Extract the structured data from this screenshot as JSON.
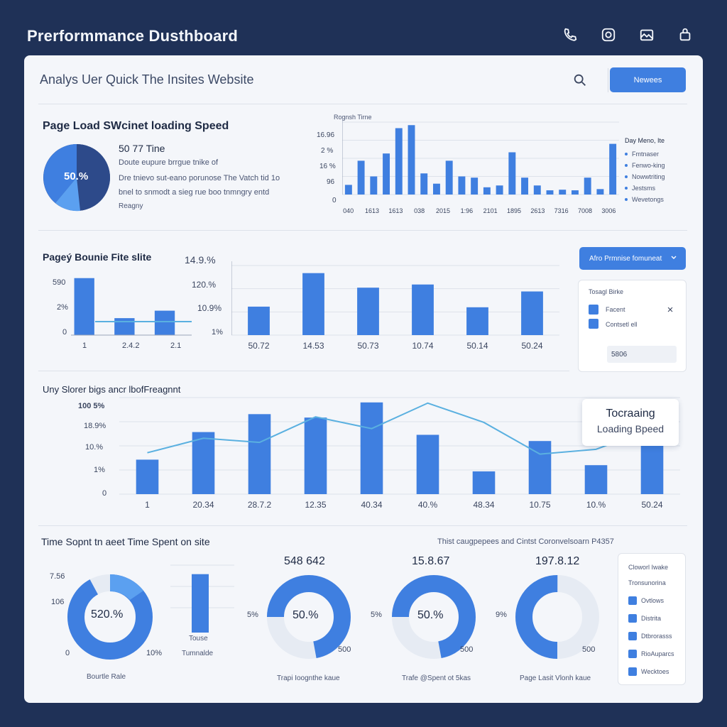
{
  "app_title": "Prerformmance Dusthboard",
  "top_icons": [
    "phone-icon",
    "camera-icon",
    "image-icon",
    "bag-icon"
  ],
  "header": {
    "subtitle": "Analys Uer Quick The Insites Website",
    "button_label": "Newees"
  },
  "colors": {
    "accent": "#3f7fe0",
    "dark": "#1f3157",
    "panel": "#f4f6fa",
    "line": "#5ab0e0"
  },
  "section1": {
    "title": "Page Load SWcinet loading Speed",
    "donut_label": "50.%",
    "info_value": "50 77 Tine",
    "info_lines": [
      "Doute eupure brrgue tnike of",
      "Dre tnievo sut-eano porunose The Vatch tid 1o",
      "bnel to snmodt a sieg rue boo tnmngry entd",
      "Reagny"
    ],
    "chart_title": "Rognsh Tirne",
    "y_ticks": [
      "16.96",
      "2 %",
      "16 %",
      "96",
      "0"
    ],
    "x_ticks": [
      "040",
      "1613",
      "1613",
      "038",
      "2015",
      "1:96",
      "2101",
      "1895",
      "2613",
      "7316",
      "7008",
      "3006"
    ],
    "legend_title": "Day Meno, Ite",
    "legend_items": [
      "Fmtnaser",
      "Fenwo-king",
      "Nowwtriting",
      "Jestsms",
      "Wevetongs"
    ]
  },
  "chart_data": [
    {
      "type": "bar",
      "title": "Rognsh Tirne",
      "values": [
        16,
        56,
        30,
        68,
        110,
        115,
        35,
        18,
        56,
        30,
        28,
        12,
        15,
        70,
        28,
        15,
        7,
        8,
        7,
        28,
        9,
        84
      ],
      "ylim": [
        0,
        120
      ]
    },
    {
      "type": "bar",
      "title": "Pageý Bounie Fite slite",
      "values": [
        84,
        25,
        36
      ],
      "y_ticks": [
        "590",
        "2%",
        "0"
      ],
      "x_ticks": [
        "1",
        "2.4.2",
        "2.1"
      ],
      "ylim": [
        0,
        90
      ]
    },
    {
      "type": "bar",
      "values": [
        45,
        98,
        75,
        80,
        44,
        69
      ],
      "y_ticks": [
        "14.9.%",
        "120.%",
        "10.9%",
        "1%"
      ],
      "x_ticks": [
        "50.72",
        "14.53",
        "50.73",
        "10.74",
        "50.14",
        "50.24"
      ],
      "ylim": [
        0,
        110
      ]
    },
    {
      "type": "bar",
      "title": "Uny Slorer bigs ancr lbofFreagnnt",
      "series": [
        {
          "values": [
            50,
            90,
            116,
            111,
            133,
            86,
            33,
            77,
            42,
            70
          ]
        },
        {
          "values": [
            60,
            81,
            75,
            112,
            95,
            132,
            104,
            58,
            65,
            95
          ]
        }
      ],
      "y_ticks": [
        "100 5%",
        "18.9%",
        "10.%",
        "1%",
        "0"
      ],
      "x_ticks": [
        "1",
        "20.34",
        "28.7.2",
        "12.35",
        "40.34",
        "40.%",
        "48.34",
        "10.75",
        "10.%",
        "50.24"
      ],
      "ylim": [
        0,
        140
      ]
    }
  ],
  "section2": {
    "title": "Pageý Bounie Fite slite",
    "dropdown_label": "Afro Prmnise fomuneat",
    "filter": {
      "title": "Tosagl Birke",
      "items": [
        "Facent",
        "Contsetl ell"
      ],
      "input_value": "5806"
    }
  },
  "section3": {
    "title": "Uny Slorer bigs ancr lbofFreagnnt",
    "tooltip": {
      "line1": "Tocraaing",
      "line2": "Loading Bpeed"
    }
  },
  "section4": {
    "title": "Time Sopnt tn aeet Time Spent on site",
    "subtitle": "Thist caugpepees  and  Cintst Coronvelsoarn P4357",
    "bounce": {
      "donut_label": "520.%",
      "y_ticks": [
        "7.56",
        "106",
        "0"
      ],
      "end_tick": "10%",
      "caption": "Bourtle Rale",
      "bar_label1": "Touse",
      "bar_label2": "Tumnalde",
      "donut_fill": 0.92,
      "bar_fill": 0.82
    },
    "gauges": [
      {
        "value": "548 642",
        "center": "50.%",
        "left": "5%",
        "right": "500",
        "caption": "Trapi Ioognthe kaue",
        "fill": 0.72
      },
      {
        "value": "15.8.67",
        "center": "50.%",
        "left": "5%",
        "right": "500",
        "caption": "Trafe @Spent ot 5kas",
        "fill": 0.72
      },
      {
        "value": "197.8.12",
        "center": "",
        "left": "9%",
        "right": "500",
        "caption": "Page Lasit Vlonh kaue",
        "fill": 0.5
      }
    ],
    "legend_card": {
      "title1": "Cloworl Iwake",
      "title2": "Tronsunorina",
      "items": [
        "Ovtlows",
        "Distrita",
        "Dtbrorasss",
        "RioAuparcs",
        "Wecktoes"
      ]
    }
  }
}
